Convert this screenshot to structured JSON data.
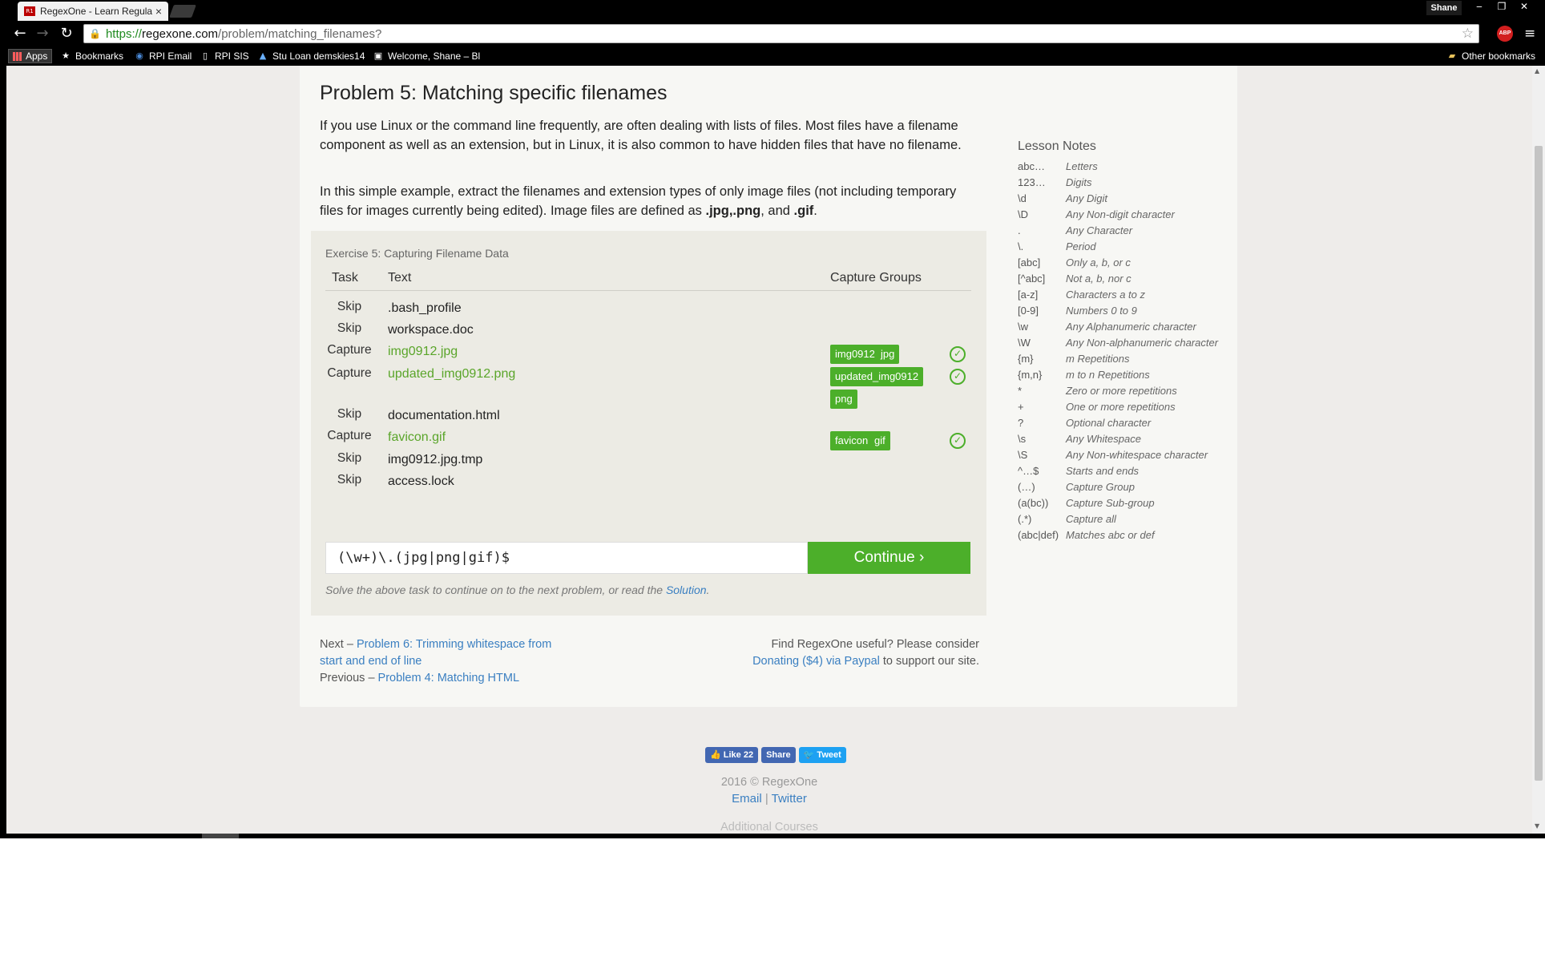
{
  "browser": {
    "tab_title": "RegexOne - Learn Regula",
    "profile": "Shane",
    "url_scheme": "https://",
    "url_host": "regexone.com",
    "url_path": "/problem/matching_filenames?",
    "abp_label": "ABP",
    "bookmarks": [
      "Apps",
      "Bookmarks",
      "RPI Email",
      "RPI SIS",
      "Stu Loan demskies14",
      "Welcome, Shane – Bl"
    ],
    "other_bookmarks": "Other bookmarks"
  },
  "problem": {
    "title": "Problem 5: Matching specific filenames",
    "para1": "If you use Linux or the command line frequently, are often dealing with lists of files. Most files have a filename component as well as an extension, but in Linux, it is also common to have hidden files that have no filename.",
    "para2_prefix": "In this simple example, extract the filenames and extension types of only image files (not including temporary files for images currently being edited). Image files are defined as ",
    "para2_ext1": ".jpg",
    "para2_comma1": ",",
    "para2_ext2": ".png",
    "para2_and": ", and ",
    "para2_ext3": ".gif",
    "para2_end": "."
  },
  "exercise": {
    "title": "Exercise 5: Capturing Filename Data",
    "headers": {
      "task": "Task",
      "text": "Text",
      "groups": "Capture Groups"
    },
    "rows": [
      {
        "task": "Skip",
        "text": ".bash_profile"
      },
      {
        "task": "Skip",
        "text": "workspace.doc"
      },
      {
        "task": "Capture",
        "text": "img0912.jpg",
        "groups": [
          "img0912",
          "jpg"
        ]
      },
      {
        "task": "Capture",
        "text": "updated_img0912.png",
        "groups": [
          "updated_img0912",
          "png"
        ]
      },
      {
        "task": "Skip",
        "text": "documentation.html"
      },
      {
        "task": "Capture",
        "text": "favicon.gif",
        "groups": [
          "favicon",
          "gif"
        ]
      },
      {
        "task": "Skip",
        "text": "img0912.jpg.tmp"
      },
      {
        "task": "Skip",
        "text": "access.lock"
      }
    ],
    "input_value": "(\\w+)\\.(jpg|png|gif)$",
    "continue_label": "Continue ›",
    "hint_prefix": "Solve the above task to continue on to the next problem, or read the ",
    "hint_link": "Solution",
    "hint_suffix": "."
  },
  "nav": {
    "next_prefix": "Next – ",
    "next_link": "Problem 6: Trimming whitespace from start and end of line",
    "prev_prefix": "Previous – ",
    "prev_link": "Problem 4: Matching HTML",
    "donate_prefix": "Find RegexOne useful? Please consider",
    "donate_link": "Donating ($4) via Paypal",
    "donate_suffix": " to support our site."
  },
  "notes": {
    "title": "Lesson Notes",
    "items": [
      {
        "sym": "abc…",
        "desc": "Letters"
      },
      {
        "sym": "123…",
        "desc": "Digits"
      },
      {
        "sym": "\\d",
        "desc": "Any Digit"
      },
      {
        "sym": "\\D",
        "desc": "Any Non-digit character"
      },
      {
        "sym": ".",
        "desc": "Any Character"
      },
      {
        "sym": "\\.",
        "desc": "Period"
      },
      {
        "sym": "[abc]",
        "desc": "Only a, b, or c"
      },
      {
        "sym": "[^abc]",
        "desc": "Not a, b, nor c"
      },
      {
        "sym": "[a-z]",
        "desc": "Characters a to z"
      },
      {
        "sym": "[0-9]",
        "desc": "Numbers 0 to 9"
      },
      {
        "sym": "\\w",
        "desc": "Any Alphanumeric character"
      },
      {
        "sym": "\\W",
        "desc": "Any Non-alphanumeric character"
      },
      {
        "sym": "{m}",
        "desc": "m Repetitions"
      },
      {
        "sym": "{m,n}",
        "desc": "m to n Repetitions"
      },
      {
        "sym": "*",
        "desc": "Zero or more repetitions"
      },
      {
        "sym": "+",
        "desc": "One or more repetitions"
      },
      {
        "sym": "?",
        "desc": "Optional character"
      },
      {
        "sym": "\\s",
        "desc": "Any Whitespace"
      },
      {
        "sym": "\\S",
        "desc": "Any Non-whitespace character"
      },
      {
        "sym": "^…$",
        "desc": "Starts and ends"
      },
      {
        "sym": "(…)",
        "desc": "Capture Group"
      },
      {
        "sym": "(a(bc))",
        "desc": "Capture Sub-group"
      },
      {
        "sym": "(.*)",
        "desc": "Capture all"
      },
      {
        "sym": "(abc|def)",
        "desc": "Matches abc or def"
      }
    ]
  },
  "footer": {
    "like": "Like 22",
    "share": "Share",
    "tweet": "Tweet",
    "copyright": "2016 © RegexOne",
    "email": "Email",
    "separator": " | ",
    "twitter": "Twitter",
    "additional": "Additional Courses"
  },
  "colors": {
    "accent_green": "#4caf2a",
    "link_blue": "#3a7fc1"
  },
  "icons": [
    "back-icon",
    "forward-icon",
    "reload-icon",
    "lock-icon",
    "star-icon",
    "menu-icon",
    "check-icon",
    "folder-icon"
  ]
}
